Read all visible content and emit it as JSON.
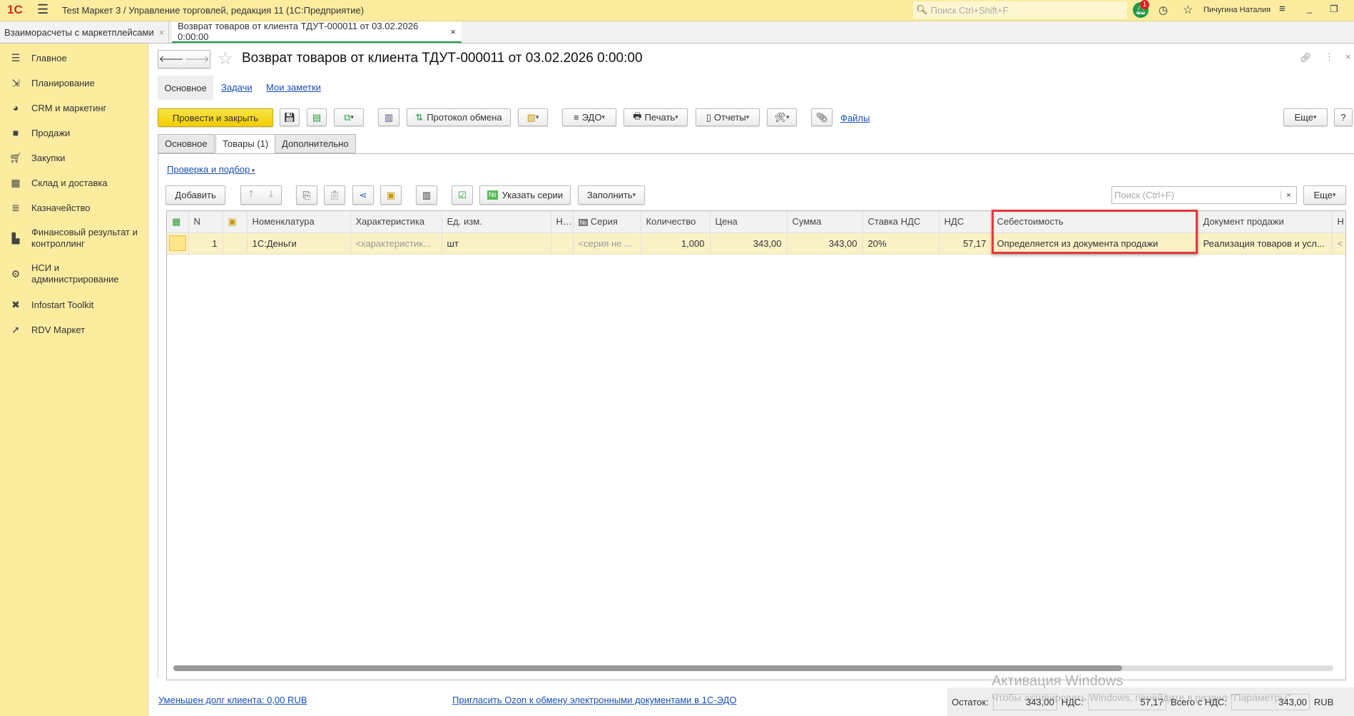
{
  "app": {
    "title": "Test Маркет 3 / Управление торговлей, редакция 11  (1С:Предприятие)",
    "search_placeholder": "Поиск Ctrl+Shift+F",
    "notification_count": "1",
    "user": "Пичугина Наталия"
  },
  "tabs": [
    {
      "label": "Взаиморасчеты с маркетплейсами"
    },
    {
      "label": "Возврат товаров от клиента ТДУТ-000011 от 03.02.2026 0:00:00"
    }
  ],
  "sidebar": {
    "items": [
      {
        "label": "Главное"
      },
      {
        "label": "Планирование"
      },
      {
        "label": "CRM и маркетинг"
      },
      {
        "label": "Продажи"
      },
      {
        "label": "Закупки"
      },
      {
        "label": "Склад и доставка"
      },
      {
        "label": "Казначейство"
      },
      {
        "label": "Финансовый результат и контроллинг"
      },
      {
        "label": "НСИ и администрирование"
      },
      {
        "label": "Infostart Toolkit"
      },
      {
        "label": "RDV Маркет"
      }
    ]
  },
  "document": {
    "title": "Возврат товаров от клиента ТДУТ-000011 от 03.02.2026 0:00:00",
    "nav": [
      "Основное",
      "Задачи",
      "Мои заметки"
    ],
    "toolbar": {
      "post_close": "Провести и закрыть",
      "exchange_protocol": "Протокол обмена",
      "edo": "ЭДО",
      "print": "Печать",
      "reports": "Отчеты",
      "files": "Файлы",
      "more": "Еще",
      "help": "?"
    },
    "form_tabs": [
      "Основное",
      "Товары (1)",
      "Дополнительно"
    ],
    "check_link": "Проверка и подбор",
    "table_toolbar": {
      "add": "Добавить",
      "series": "Указать серии",
      "fill": "Заполнить",
      "search_placeholder": "Поиск (Ctrl+F)",
      "more": "Еще"
    },
    "columns": [
      "N",
      "Номенклатура",
      "Характеристика",
      "Ед. изм.",
      "Н..",
      "Серия",
      "Количество",
      "Цена",
      "Сумма",
      "Ставка НДС",
      "НДС",
      "Себестоимость",
      "Документ продажи",
      "Н"
    ],
    "rows": [
      {
        "n": "1",
        "item": "1С:Деньги",
        "char": "<характеристик...",
        "unit": "шт",
        "h": "",
        "series": "<серия не ...",
        "qty": "1,000",
        "price": "343,00",
        "sum": "343,00",
        "vat_rate": "20%",
        "vat": "57,17",
        "cost": "Определяется из документа продажи",
        "sale_doc": "Реализация товаров и усл...",
        "extra": "<"
      }
    ]
  },
  "footer": {
    "debt_link": "Уменьшен долг клиента: 0,00 RUB",
    "ozon_link": "Пригласить Ozon к обмену электронными документами в 1С-ЭДО",
    "balance_label": "Остаток:",
    "balance": "343,00",
    "vat_label": "НДС:",
    "vat": "57,17",
    "total_label": "Всего с НДС:",
    "total": "343,00",
    "currency": "RUB"
  },
  "watermark": {
    "title": "Активация Windows",
    "text": "Чтобы активировать Windows, перейдите в раздел \"Параметры\"."
  },
  "colors": {
    "accent_yellow": "#f5d50a",
    "highlight": "#e8383d",
    "sidebar": "#fbeca0"
  }
}
